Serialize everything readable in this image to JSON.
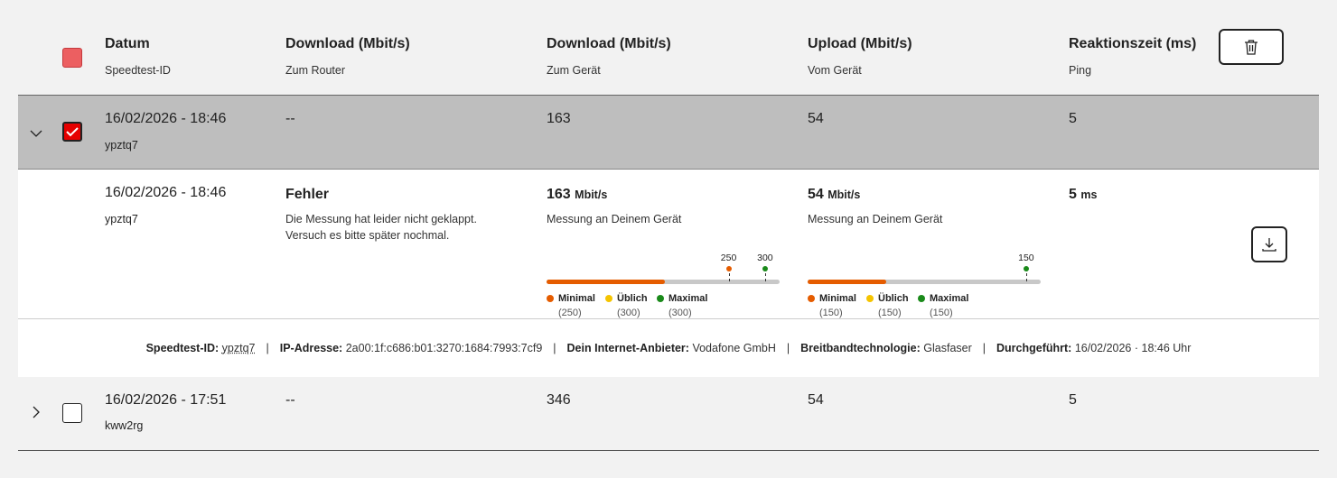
{
  "header": {
    "columns": [
      {
        "title": "Datum",
        "sub": "Speedtest-ID"
      },
      {
        "title": "Download (Mbit/s)",
        "sub": "Zum Router"
      },
      {
        "title": "Download (Mbit/s)",
        "sub": "Zum Gerät"
      },
      {
        "title": "Upload (Mbit/s)",
        "sub": "Vom Gerät"
      },
      {
        "title": "Reaktionszeit (ms)",
        "sub": "Ping"
      }
    ],
    "delete_icon": "trash-icon"
  },
  "rows": [
    {
      "date": "16/02/2026 - 18:46",
      "id": "ypztq7",
      "router": "--",
      "device_down": "163",
      "device_up": "54",
      "ping": "5",
      "checked": true,
      "expanded": true
    },
    {
      "date": "16/02/2026 - 17:51",
      "id": "kww2rg",
      "router": "--",
      "device_down": "346",
      "device_up": "54",
      "ping": "5",
      "checked": false,
      "expanded": false
    }
  ],
  "detail": {
    "date": "16/02/2026 - 18:46",
    "id": "ypztq7",
    "error_title": "Fehler",
    "error_text": "Die Messung hat leider nicht geklappt. Versuch es bitte später nochmal.",
    "download": {
      "value": "163",
      "unit": "Mbit/s",
      "caption": "Messung an Deinem Gerät",
      "max_scale": 320,
      "fill": 163,
      "markers": [
        {
          "label": "250",
          "value": 250,
          "color": "#e55c00"
        },
        {
          "label": "300",
          "value": 300,
          "color": "#1a8a1a"
        }
      ],
      "legend": [
        {
          "label": "Minimal",
          "value": "(250)",
          "color": "#e55c00"
        },
        {
          "label": "Üblich",
          "value": "(300)",
          "color": "#f5c400"
        },
        {
          "label": "Maximal",
          "value": "(300)",
          "color": "#1a8a1a"
        }
      ]
    },
    "upload": {
      "value": "54",
      "unit": "Mbit/s",
      "caption": "Messung an Deinem Gerät",
      "max_scale": 160,
      "fill": 54,
      "markers": [
        {
          "label": "150",
          "value": 150,
          "color": "#1a8a1a"
        }
      ],
      "legend": [
        {
          "label": "Minimal",
          "value": "(150)",
          "color": "#e55c00"
        },
        {
          "label": "Üblich",
          "value": "(150)",
          "color": "#f5c400"
        },
        {
          "label": "Maximal",
          "value": "(150)",
          "color": "#1a8a1a"
        }
      ]
    },
    "ping": {
      "value": "5",
      "unit": "ms"
    },
    "download_icon": "download-icon"
  },
  "info": {
    "speedtest_id_label": "Speedtest-ID:",
    "speedtest_id": "ypztq7",
    "ip_label": "IP-Adresse:",
    "ip": "2a00:1f:c686:b01:3270:1684:7993:7cf9",
    "provider_label": "Dein Internet-Anbieter:",
    "provider": "Vodafone GmbH",
    "tech_label": "Breitbandtechnologie:",
    "tech": "Glasfaser",
    "done_label": "Durchgeführt:",
    "done": "16/02/2026 · 18:46 Uhr",
    "separator": "|"
  }
}
